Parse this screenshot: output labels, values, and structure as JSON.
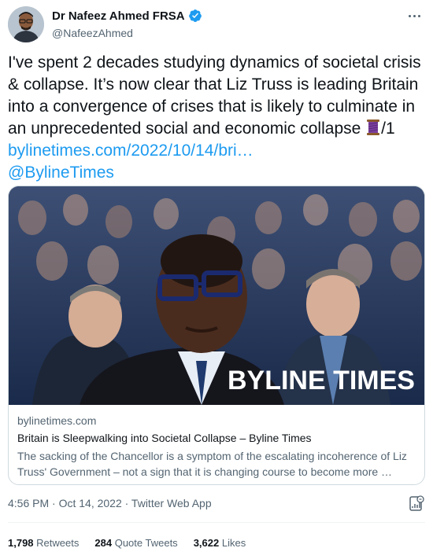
{
  "author": {
    "display_name": "Dr Nafeez Ahmed FRSA",
    "handle": "@NafeezAhmed",
    "verified": true
  },
  "tweet": {
    "text_main": "I've spent 2 decades studying dynamics of societal crisis & collapse. It’s now clear that Liz Truss is leading Britain into a convergence of crises that is likely to culminate in an unprecedented social and economic collapse ",
    "emoji": "spool-of-thread-icon",
    "thread_marker": "/1 ",
    "link_text": "bylinetimes.com/2022/10/14/bri…",
    "mention": "@BylineTimes"
  },
  "card": {
    "image_watermark": "BYLINE TIMES",
    "domain": "bylinetimes.com",
    "title": "Britain is Sleepwalking into Societal Collapse – Byline Times",
    "description": "The sacking of the Chancellor is a symptom of the escalating incoherence of Liz Truss' Government – not a sign that it is changing course to become more …"
  },
  "meta": {
    "timestamp": "4:56 PM · Oct 14, 2022 · Twitter Web App"
  },
  "stats": {
    "retweets_count": "1,798",
    "retweets_label": "Retweets",
    "quotes_count": "284",
    "quotes_label": "Quote Tweets",
    "likes_count": "3,622",
    "likes_label": "Likes"
  },
  "colors": {
    "link": "#1d9bf0",
    "verified_badge": "#1d9bf0",
    "secondary_text": "#536471"
  }
}
